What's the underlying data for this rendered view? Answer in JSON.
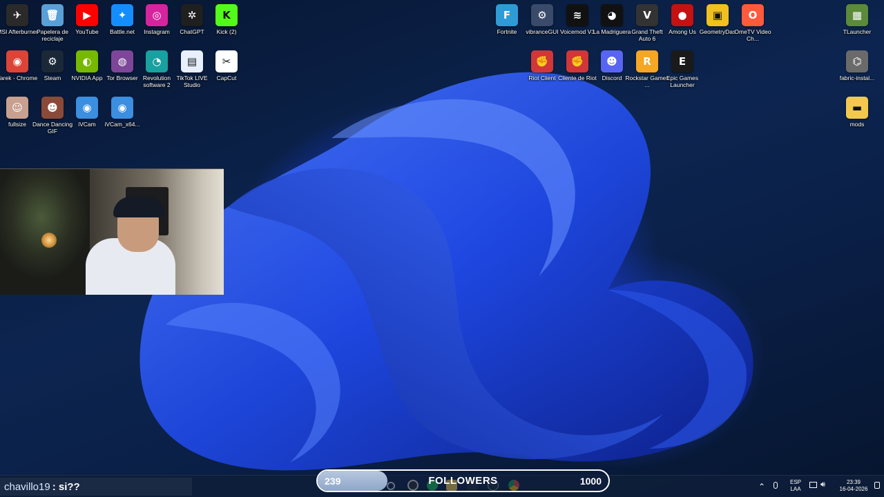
{
  "desktop": {
    "left_icons": [
      {
        "label": "MSI Afterburner",
        "icon": "msi-afterburner-icon",
        "color": "#2a2a2a",
        "glyph": "✈"
      },
      {
        "label": "Papelera de reciclaje",
        "icon": "recycle-bin-icon",
        "color": "#5aa0d8",
        "glyph": "🗑"
      },
      {
        "label": "YouTube",
        "icon": "youtube-icon",
        "color": "#ff0000",
        "glyph": "▶"
      },
      {
        "label": "Battle.net",
        "icon": "battlenet-icon",
        "color": "#148eff",
        "glyph": "✦"
      },
      {
        "label": "Instagram",
        "icon": "instagram-icon",
        "color": "#d6249f",
        "glyph": "◎"
      },
      {
        "label": "ChatGPT",
        "icon": "chatgpt-icon",
        "color": "#1f1f1f",
        "glyph": "✲"
      },
      {
        "label": "Kick (2)",
        "icon": "kick-icon",
        "color": "#53fc18",
        "glyph": "K"
      },
      {
        "label": "Tarek - Chrome",
        "icon": "chrome-icon",
        "color": "#db4437",
        "glyph": "◉"
      },
      {
        "label": "Steam",
        "icon": "steam-icon",
        "color": "#1b2838",
        "glyph": "⚙"
      },
      {
        "label": "NVIDIA App",
        "icon": "nvidia-icon",
        "color": "#76b900",
        "glyph": "◐"
      },
      {
        "label": "Tor Browser",
        "icon": "tor-browser-icon",
        "color": "#7d4698",
        "glyph": "◍"
      },
      {
        "label": "Revolution software 2",
        "icon": "revolution-icon",
        "color": "#19a0a0",
        "glyph": "◔"
      },
      {
        "label": "TikTok LIVE Studio",
        "icon": "tiktok-live-icon",
        "color": "#e8f0ff",
        "glyph": "▤"
      },
      {
        "label": "CapCut",
        "icon": "capcut-icon",
        "color": "#ffffff",
        "glyph": "✂"
      },
      {
        "label": "fullsize",
        "icon": "image-file-icon",
        "color": "#c8a090",
        "glyph": "☺"
      },
      {
        "label": "Dance Dancing GIF",
        "icon": "gif-file-icon",
        "color": "#8a4a3a",
        "glyph": "☻"
      },
      {
        "label": "iVCam",
        "icon": "ivcam-icon",
        "color": "#3b8ee0",
        "glyph": "◉"
      },
      {
        "label": "iVCam_x64...",
        "icon": "ivcam-installer-icon",
        "color": "#3b8ee0",
        "glyph": "◉"
      }
    ],
    "right_icons": [
      {
        "label": "Fortnite",
        "icon": "fortnite-icon",
        "color": "#2e9bd6",
        "glyph": "F"
      },
      {
        "label": "vibranceGUI",
        "icon": "vibrancegui-icon",
        "color": "#3a4a6a",
        "glyph": "⚙"
      },
      {
        "label": "Voicemod V3",
        "icon": "voicemod-icon",
        "color": "#111111",
        "glyph": "≋"
      },
      {
        "label": "La Madriguera",
        "icon": "folder-cat-icon",
        "color": "#111111",
        "glyph": "◕"
      },
      {
        "label": "Grand Theft Auto 6",
        "icon": "gta6-icon",
        "color": "#333333",
        "glyph": "V"
      },
      {
        "label": "Among Us",
        "icon": "among-us-icon",
        "color": "#c51111",
        "glyph": "●"
      },
      {
        "label": "GeometryDas",
        "icon": "geometry-dash-icon",
        "color": "#f0c020",
        "glyph": "▣"
      },
      {
        "label": "OmeTV Video Ch...",
        "icon": "ometv-icon",
        "color": "#ff5a3c",
        "glyph": "O"
      },
      {
        "label": "TLauncher",
        "icon": "tlauncher-icon",
        "color": "#5a8a3a",
        "glyph": "▦"
      },
      {
        "label": "Riot Client",
        "icon": "riot-client-icon",
        "color": "#d13639",
        "glyph": "✊"
      },
      {
        "label": "Cliente de Riot",
        "icon": "riot-client-icon",
        "color": "#d13639",
        "glyph": "✊"
      },
      {
        "label": "Discord",
        "icon": "discord-icon",
        "color": "#5865f2",
        "glyph": "☻"
      },
      {
        "label": "Rockstar Games ...",
        "icon": "rockstar-icon",
        "color": "#f5a623",
        "glyph": "R"
      },
      {
        "label": "Epic Games Launcher",
        "icon": "epic-games-icon",
        "color": "#1a1a1a",
        "glyph": "E"
      },
      {
        "label": "fabric-instal...",
        "icon": "jar-file-icon",
        "color": "#6a6a6a",
        "glyph": "⌬"
      },
      {
        "label": "mods",
        "icon": "folder-icon",
        "color": "#f2c94c",
        "glyph": "▬"
      }
    ]
  },
  "chat": {
    "username": "chavillo19",
    "message": ": si??"
  },
  "followers_goal": {
    "title": "FOLLOWERS",
    "current": "239",
    "goal": "1000",
    "progress": 0.239
  },
  "tray": {
    "lang_line1": "ESP",
    "lang_line2": "LAA",
    "time": "23:39",
    "date": "16-04-2026",
    "up_arrow": "⌃"
  }
}
